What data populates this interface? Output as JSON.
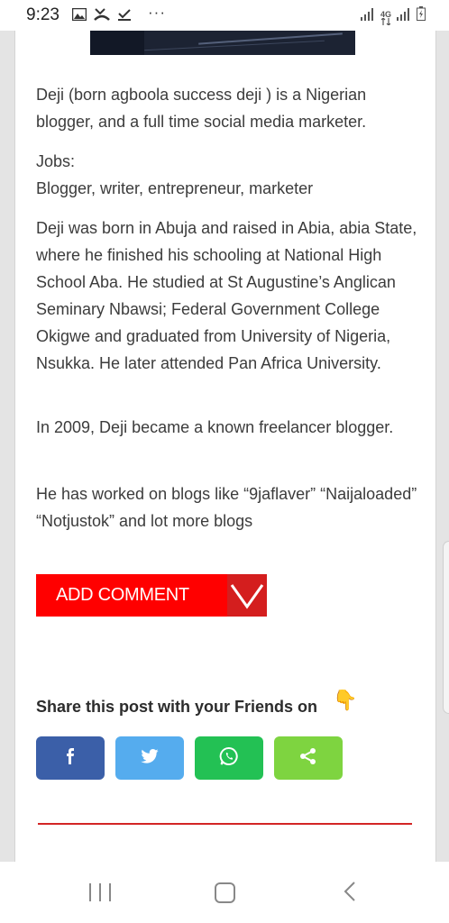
{
  "status_bar": {
    "time": "9:23",
    "more_dots": "···",
    "left_icons": [
      "image-icon",
      "missed-call-icon",
      "download-done-icon"
    ],
    "right_icons": [
      "signal-icon",
      "network-4g-icon",
      "signal-icon",
      "battery-icon"
    ],
    "network_label": "4G"
  },
  "article": {
    "paragraphs": [
      "Deji (born agboola success deji ) is a Nigerian blogger, and a full time social media marketer.",
      "Jobs:\nBlogger, writer, entrepreneur, marketer",
      "Deji was born in Abuja  and raised in Abia, abia State, where he finished his schooling at National High School Aba. He studied at St Augustine’s Anglican Seminary Nbawsi; Federal Government College Okigwe and graduated from University of Nigeria, Nsukka. He later attended Pan Africa University.",
      "In 2009, Deji became a known freelancer blogger.",
      "He has worked on blogs like “9jaflaver” “Naijaloaded” “Notjustok” and lot more blogs"
    ]
  },
  "comments": {
    "add_comment_label": "ADD COMMENT"
  },
  "share": {
    "title": "Share this post with your Friends on",
    "emoji": "👇",
    "buttons": [
      {
        "name": "facebook",
        "icon": "facebook-icon",
        "color": "#3b5fa8"
      },
      {
        "name": "twitter",
        "icon": "twitter-icon",
        "color": "#55acee"
      },
      {
        "name": "whatsapp",
        "icon": "whatsapp-icon",
        "color": "#23c154"
      },
      {
        "name": "share",
        "icon": "share-icon",
        "color": "#7ed440"
      }
    ]
  },
  "colors": {
    "accent_red": "#ff0000",
    "divider_red": "#d32525"
  },
  "nav_bar": {
    "icons": [
      "recents-icon",
      "home-icon",
      "back-icon"
    ]
  }
}
